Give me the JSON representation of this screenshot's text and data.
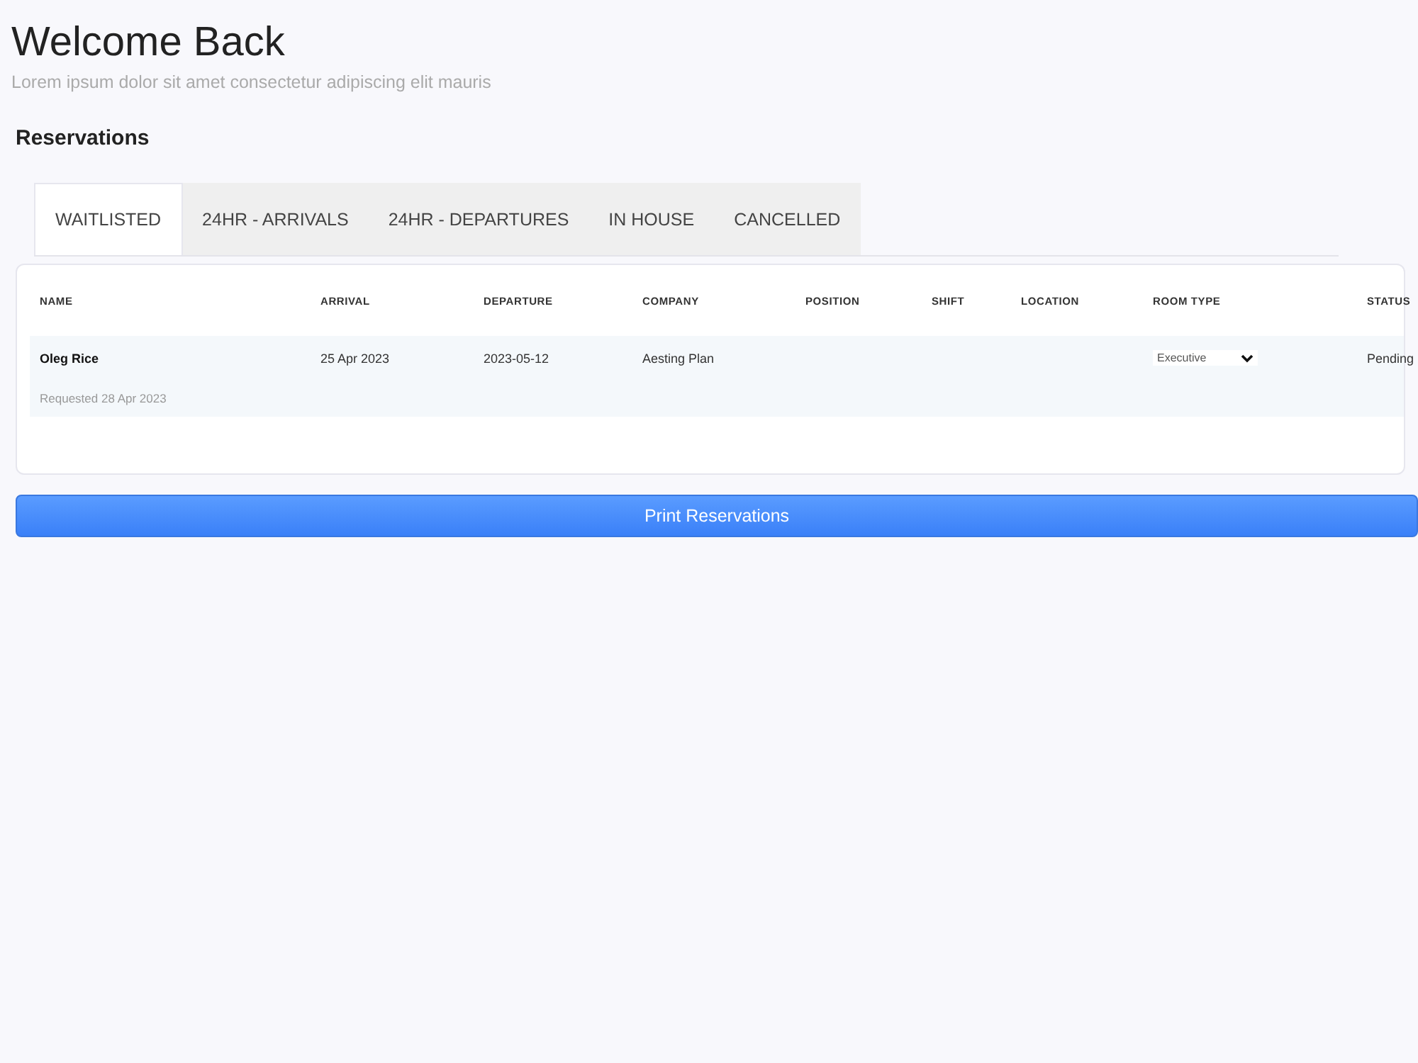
{
  "header": {
    "title": "Welcome Back",
    "subtitle": "Lorem ipsum dolor sit amet consectetur adipiscing elit mauris"
  },
  "section_title": "Reservations",
  "tabs": [
    {
      "label": "WAITLISTED",
      "selected": true
    },
    {
      "label": "24HR - ARRIVALS",
      "selected": false
    },
    {
      "label": "24HR - DEPARTURES",
      "selected": false
    },
    {
      "label": "IN HOUSE",
      "selected": false
    },
    {
      "label": "CANCELLED",
      "selected": false
    }
  ],
  "table": {
    "columns": [
      "NAME",
      "ARRIVAL",
      "DEPARTURE",
      "COMPANY",
      "POSITION",
      "SHIFT",
      "LOCATION",
      "ROOM TYPE",
      "STATUS"
    ],
    "rows": [
      {
        "name": "Oleg Rice",
        "requested": "Requested 28 Apr 2023",
        "arrival": "25 Apr 2023",
        "departure": "2023-05-12",
        "company": "Aesting Plan",
        "room_type": "Executive",
        "status": "Pending"
      }
    ]
  },
  "print_button": "Print Reservations"
}
